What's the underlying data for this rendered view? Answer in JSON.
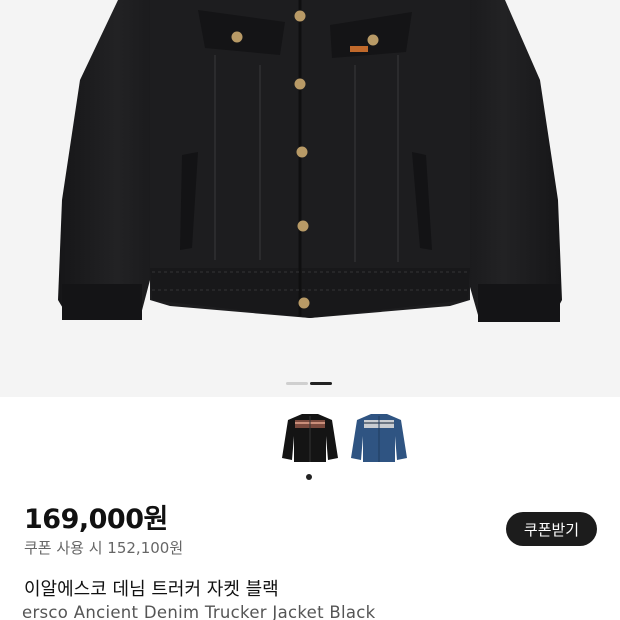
{
  "gallery": {
    "image_alt": "black denim trucker jacket",
    "pager_count": 2,
    "pager_active": 1,
    "thumbnails": [
      {
        "name": "black-jacket-thumbnail",
        "selected": true
      },
      {
        "name": "blue-jacket-thumbnail",
        "selected": false
      }
    ]
  },
  "product": {
    "price": "169,000원",
    "coupon_price": "쿠폰 사용 시 152,100원",
    "coupon_button": "쿠폰받기",
    "title_ko": "이알에스코 데님 트러커 자켓 블랙",
    "title_en": "ersco Ancient Denim Trucker Jacket Black"
  },
  "colors": {
    "jacket_black": "#1b1b1d",
    "jacket_blue": "#2f5482",
    "button_brass": "#b89a66",
    "hero_bg": "#f4f4f4",
    "coupon_button_bg": "#1c1c1c"
  }
}
